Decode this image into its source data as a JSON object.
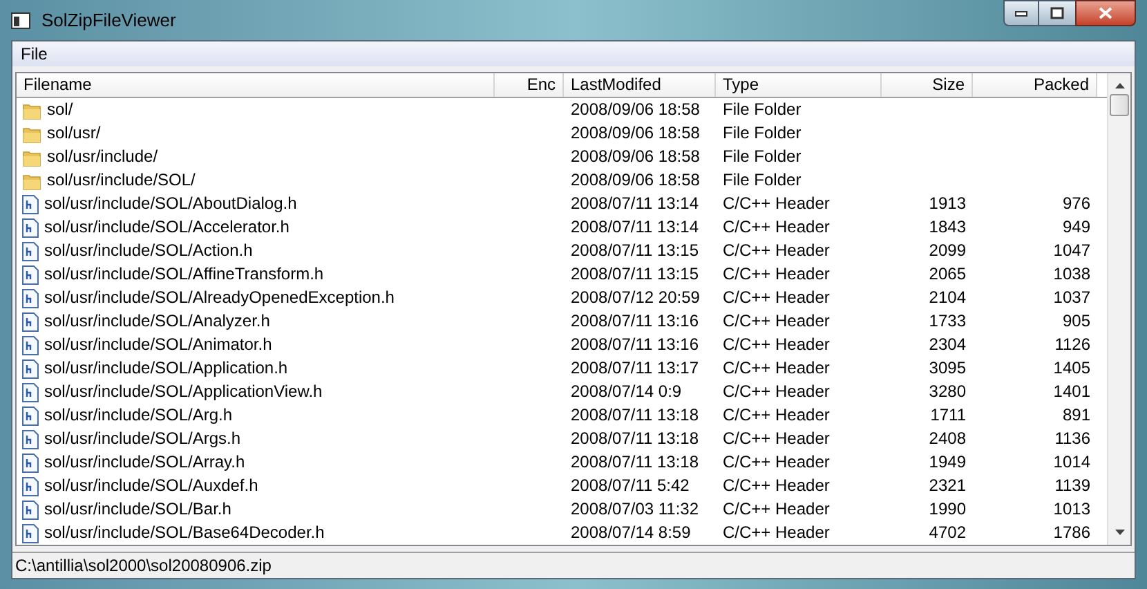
{
  "window": {
    "title": "SolZipFileViewer"
  },
  "menu": [
    "File"
  ],
  "table": {
    "columns": [
      "Filename",
      "Enc",
      "LastModifed",
      "Type",
      "Size",
      "Packed"
    ],
    "rows": [
      {
        "kind": "folder",
        "name": "sol/",
        "modified": "2008/09/06 18:58",
        "type": "File Folder"
      },
      {
        "kind": "folder",
        "name": "sol/usr/",
        "modified": "2008/09/06 18:58",
        "type": "File Folder"
      },
      {
        "kind": "folder",
        "name": "sol/usr/include/",
        "modified": "2008/09/06 18:58",
        "type": "File Folder"
      },
      {
        "kind": "folder",
        "name": "sol/usr/include/SOL/",
        "modified": "2008/09/06 18:58",
        "type": "File Folder"
      },
      {
        "kind": "file",
        "name": "sol/usr/include/SOL/AboutDialog.h",
        "modified": "2008/07/11 13:14",
        "type": "C/C++ Header",
        "size": "1913",
        "packed": "976"
      },
      {
        "kind": "file",
        "name": "sol/usr/include/SOL/Accelerator.h",
        "modified": "2008/07/11 13:14",
        "type": "C/C++ Header",
        "size": "1843",
        "packed": "949"
      },
      {
        "kind": "file",
        "name": "sol/usr/include/SOL/Action.h",
        "modified": "2008/07/11 13:15",
        "type": "C/C++ Header",
        "size": "2099",
        "packed": "1047"
      },
      {
        "kind": "file",
        "name": "sol/usr/include/SOL/AffineTransform.h",
        "modified": "2008/07/11 13:15",
        "type": "C/C++ Header",
        "size": "2065",
        "packed": "1038"
      },
      {
        "kind": "file",
        "name": "sol/usr/include/SOL/AlreadyOpenedException.h",
        "modified": "2008/07/12 20:59",
        "type": "C/C++ Header",
        "size": "2104",
        "packed": "1037"
      },
      {
        "kind": "file",
        "name": "sol/usr/include/SOL/Analyzer.h",
        "modified": "2008/07/11 13:16",
        "type": "C/C++ Header",
        "size": "1733",
        "packed": "905"
      },
      {
        "kind": "file",
        "name": "sol/usr/include/SOL/Animator.h",
        "modified": "2008/07/11 13:16",
        "type": "C/C++ Header",
        "size": "2304",
        "packed": "1126"
      },
      {
        "kind": "file",
        "name": "sol/usr/include/SOL/Application.h",
        "modified": "2008/07/11 13:17",
        "type": "C/C++ Header",
        "size": "3095",
        "packed": "1405"
      },
      {
        "kind": "file",
        "name": "sol/usr/include/SOL/ApplicationView.h",
        "modified": "2008/07/14 0:9",
        "type": "C/C++ Header",
        "size": "3280",
        "packed": "1401"
      },
      {
        "kind": "file",
        "name": "sol/usr/include/SOL/Arg.h",
        "modified": "2008/07/11 13:18",
        "type": "C/C++ Header",
        "size": "1711",
        "packed": "891"
      },
      {
        "kind": "file",
        "name": "sol/usr/include/SOL/Args.h",
        "modified": "2008/07/11 13:18",
        "type": "C/C++ Header",
        "size": "2408",
        "packed": "1136"
      },
      {
        "kind": "file",
        "name": "sol/usr/include/SOL/Array.h",
        "modified": "2008/07/11 13:18",
        "type": "C/C++ Header",
        "size": "1949",
        "packed": "1014"
      },
      {
        "kind": "file",
        "name": "sol/usr/include/SOL/Auxdef.h",
        "modified": "2008/07/11 5:42",
        "type": "C/C++ Header",
        "size": "2321",
        "packed": "1139"
      },
      {
        "kind": "file",
        "name": "sol/usr/include/SOL/Bar.h",
        "modified": "2008/07/03 11:32",
        "type": "C/C++ Header",
        "size": "1990",
        "packed": "1013"
      },
      {
        "kind": "file",
        "name": "sol/usr/include/SOL/Base64Decoder.h",
        "modified": "2008/07/14 8:59",
        "type": "C/C++ Header",
        "size": "4702",
        "packed": "1786"
      }
    ]
  },
  "status_bar": "C:\\antillia\\sol2000\\sol20080906.zip"
}
